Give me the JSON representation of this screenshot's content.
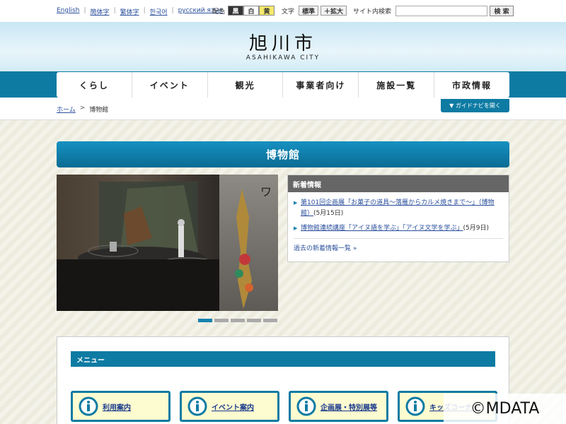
{
  "utility": {
    "languages": [
      "English",
      "簡体字",
      "繁体字",
      "한국어",
      "русский язык"
    ],
    "color_label": "配色",
    "color_options": [
      "黒",
      "白",
      "黄"
    ],
    "size_label": "文字",
    "size_options": [
      "標準",
      "＋拡大"
    ],
    "search_label": "サイト内検索",
    "search_value": "",
    "search_button": "検 索"
  },
  "header": {
    "logo": "旭川市",
    "logo_sub": "ASAHIKAWA CITY"
  },
  "nav": [
    "くらし",
    "イベント",
    "観光",
    "事業者向け",
    "施設一覧",
    "市政情報"
  ],
  "breadcrumb": {
    "home": "ホーム",
    "separator": ">",
    "current": "博物館",
    "guide_button": "▼ ガイドナビを開く"
  },
  "page_title": "博物館",
  "slider": {
    "count": 5,
    "active_index": 0
  },
  "news": {
    "heading": "新着情報",
    "items": [
      {
        "text": "第101回企画展「お菓子の道具～落雁からカルメ焼きまで～」（博物館）",
        "date": "(5月15日)"
      },
      {
        "text": "博物館連続講座「アイヌ語を学ぶ」「アイヌ文学を学ぶ」",
        "date": "(5月9日)"
      }
    ],
    "more": "過去の新着情報一覧 »"
  },
  "menu": {
    "heading": "メニュー",
    "cards": [
      "利用案内",
      "イベント案内",
      "企画展・特別展等",
      "キッズコーナー"
    ]
  },
  "watermark": "©MDATA",
  "colors": {
    "accent": "#0e7ba3",
    "card_bg": "#fdfbd0"
  }
}
